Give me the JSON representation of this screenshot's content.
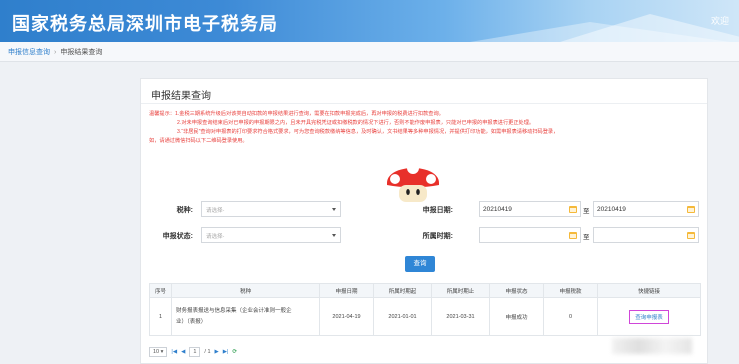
{
  "header": {
    "title": "国家税务总局深圳市电子税务局",
    "welcome": "欢迎"
  },
  "breadcrumb": {
    "home": "申报信息查询",
    "current": "申报结果查询"
  },
  "panel": {
    "title": "申报结果查询",
    "notice": [
      "温馨提示：1.金税三期系统升级后对该类自动扣款的申报结果进行查询，需要在扣款申报完成后，再对申报的税费进行扣款查询。",
      "2.对未申报查询结束后对已申报的申报期限之内，且未开具完税凭证或扣缴税款的情况下进行，否则不能作废申报表，只能对已申报的申报表进行更正处理。",
      "3.“非居民”查询对申报表的打印要求符合格式要求，可为您查询税款缴纳等信息，及时确认，文书结果等多种申报情况，并提供打印功能，如需申报表请移动扫码登录，",
      "如，请通过微信扫码以下二维码登录使用。"
    ],
    "form": {
      "tax_type_label": "税种:",
      "tax_type_placeholder": "请选择-",
      "status_label": "申报状态:",
      "status_placeholder": "请选择-",
      "declare_date_label": "申报日期:",
      "declare_date_from": "20210419",
      "declare_date_to": "20210419",
      "period_label": "所属时期:",
      "period_from": "",
      "period_to": "",
      "to_label": "至",
      "query_button": "查询"
    },
    "table": {
      "headers": [
        "序号",
        "税种",
        "申报日期",
        "所属时期起",
        "所属时期止",
        "申报状态",
        "申报税款",
        "快捷链接"
      ],
      "rows": [
        {
          "index": "1",
          "tax_line1": "财务报表报送与信息采集（企业会计准则一般企",
          "tax_line2": "业）（表报）",
          "declare_date": "2021-04-19",
          "period_start": "2021-01-01",
          "period_end": "2021-03-31",
          "status": "申报成功",
          "amount": "0",
          "link": "查询申报表"
        }
      ]
    },
    "pager": {
      "page_size": "10 ▾",
      "first": "|◀",
      "prev": "◀",
      "page": "1",
      "of": "/ 1",
      "next": "▶",
      "last": "▶|",
      "refresh": "⟳"
    }
  },
  "colors": {
    "header_blue": "#2f7fcc",
    "notice_red": "#e8403d",
    "query_btn": "#2f86d6",
    "link_highlight": "#d046d9",
    "calendar": "#f5b93a"
  },
  "icons": {
    "calendar": "calendar-icon",
    "mushroom": "mushroom-mascot-icon",
    "refresh": "refresh-icon"
  }
}
